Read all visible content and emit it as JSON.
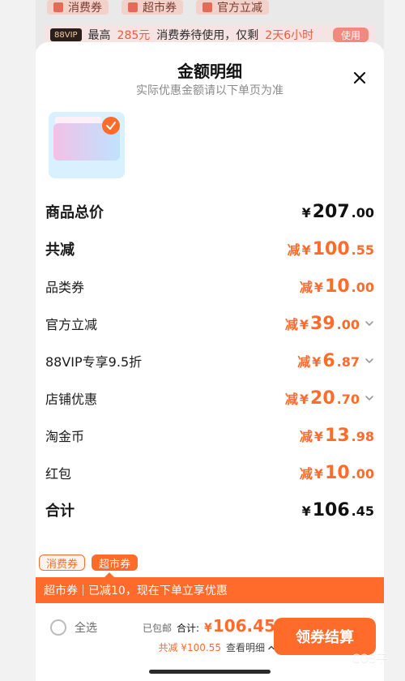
{
  "background": {
    "chips": [
      {
        "label": "消费券",
        "icon": "coupon-icon"
      },
      {
        "label": "超市券",
        "icon": "supermarket-icon"
      },
      {
        "label": "官方立减",
        "icon": "bolt-icon"
      }
    ],
    "banner": {
      "vip_tag": "88VIP",
      "text_prefix": "最高",
      "amount": "285元",
      "text_middle": "消费券待使用，仅剩",
      "remaining": "2天6小时",
      "use_label": "使用"
    }
  },
  "modal": {
    "title": "金额明细",
    "subtitle": "实际优惠金额请以下单页为准",
    "close_icon": "close-icon"
  },
  "rows": [
    {
      "label": "商品总价",
      "prefix": "",
      "yen": "¥",
      "int": "207",
      "dec": ".00",
      "chevron": false,
      "strong": true,
      "tone": "dark"
    },
    {
      "label": "共减",
      "prefix": "减",
      "yen": "¥",
      "int": "100",
      "dec": ".55",
      "chevron": false,
      "strong": true,
      "tone": "orange"
    },
    {
      "label": "品类券",
      "prefix": "减",
      "yen": "¥",
      "int": "10",
      "dec": ".00",
      "chevron": false,
      "strong": false,
      "tone": "orange"
    },
    {
      "label": "官方立减",
      "prefix": "减",
      "yen": "¥",
      "int": "39",
      "dec": ".00",
      "chevron": true,
      "strong": false,
      "tone": "orange"
    },
    {
      "label": "88VIP专享9.5折",
      "prefix": "减",
      "yen": "¥",
      "int": "6",
      "dec": ".87",
      "chevron": true,
      "strong": false,
      "tone": "orange"
    },
    {
      "label": "店铺优惠",
      "prefix": "减",
      "yen": "¥",
      "int": "20",
      "dec": ".70",
      "chevron": true,
      "strong": false,
      "tone": "orange"
    },
    {
      "label": "淘金币",
      "prefix": "减",
      "yen": "¥",
      "int": "13",
      "dec": ".98",
      "chevron": false,
      "strong": false,
      "tone": "orange"
    },
    {
      "label": "红包",
      "prefix": "减",
      "yen": "¥",
      "int": "10",
      "dec": ".00",
      "chevron": false,
      "strong": false,
      "tone": "orange"
    },
    {
      "label": "合计",
      "prefix": "",
      "yen": "¥",
      "int": "106",
      "dec": ".45",
      "chevron": false,
      "strong": true,
      "tone": "dark"
    }
  ],
  "tabs": [
    {
      "label": "消费券",
      "active": false
    },
    {
      "label": "超市券",
      "active": true
    }
  ],
  "promo": {
    "label": "超市券",
    "text": "已减10，现在下单立享优惠"
  },
  "footer": {
    "select_all": "全选",
    "shipping": "已包邮",
    "total_label": "合计:",
    "total_yen": "¥",
    "total_value": "106.45",
    "discount": "共减 ¥100.55",
    "detail": "查看明细",
    "claim_button": "领券结算",
    "watermark": "COS平"
  },
  "colors": {
    "accent": "#ff6b2b",
    "dark_text": "#111111"
  }
}
